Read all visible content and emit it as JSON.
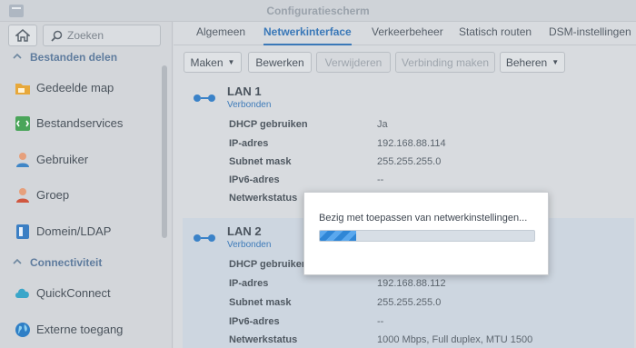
{
  "window": {
    "title": "Configuratiescherm"
  },
  "sidebar": {
    "search_placeholder": "Zoeken",
    "sections": [
      {
        "label": "Bestanden delen"
      },
      {
        "label": "Connectiviteit"
      }
    ],
    "items": [
      {
        "label": "Gedeelde map",
        "icon": "folder-share-icon"
      },
      {
        "label": "Bestandservices",
        "icon": "file-services-icon"
      },
      {
        "label": "Gebruiker",
        "icon": "user-icon"
      },
      {
        "label": "Groep",
        "icon": "group-icon"
      },
      {
        "label": "Domein/LDAP",
        "icon": "domain-ldap-icon"
      },
      {
        "label": "QuickConnect",
        "icon": "quickconnect-icon"
      },
      {
        "label": "Externe toegang",
        "icon": "globe-icon"
      }
    ]
  },
  "tabs": [
    {
      "label": "Algemeen",
      "active": false
    },
    {
      "label": "Netwerkinterface",
      "active": true
    },
    {
      "label": "Verkeerbeheer",
      "active": false
    },
    {
      "label": "Statisch routen",
      "active": false
    },
    {
      "label": "DSM-instellingen",
      "active": false
    }
  ],
  "toolbar": {
    "create": "Maken",
    "edit": "Bewerken",
    "delete": "Verwijderen",
    "connect": "Verbinding maken",
    "manage": "Beheren"
  },
  "interfaces": [
    {
      "name": "LAN 1",
      "status": "Verbonden",
      "rows": [
        {
          "label": "DHCP gebruiken",
          "value": "Ja"
        },
        {
          "label": "IP-adres",
          "value": "192.168.88.114"
        },
        {
          "label": "Subnet mask",
          "value": "255.255.255.0"
        },
        {
          "label": "IPv6-adres",
          "value": "--"
        },
        {
          "label": "Netwerkstatus",
          "value": ""
        }
      ]
    },
    {
      "name": "LAN 2",
      "status": "Verbonden",
      "rows": [
        {
          "label": "DHCP gebruiken",
          "value": ""
        },
        {
          "label": "IP-adres",
          "value": "192.168.88.112"
        },
        {
          "label": "Subnet mask",
          "value": "255.255.255.0"
        },
        {
          "label": "IPv6-adres",
          "value": "--"
        },
        {
          "label": "Netwerkstatus",
          "value": "1000 Mbps, Full duplex, MTU 1500"
        }
      ]
    }
  ],
  "dialog": {
    "message": "Bezig met toepassen van netwerkinstellingen...",
    "progress_percent": 17
  },
  "colors": {
    "accent": "#3a78b8",
    "progress": "#2f86d6"
  }
}
